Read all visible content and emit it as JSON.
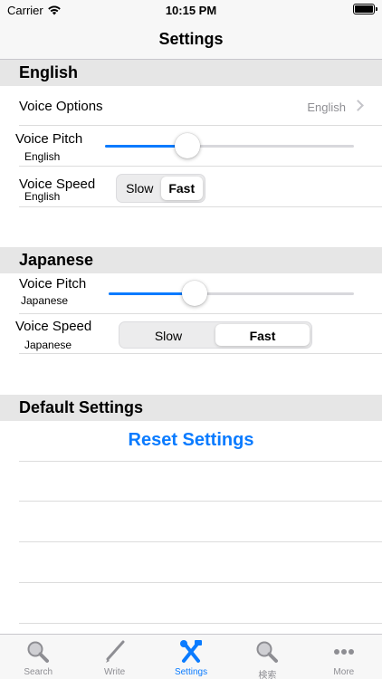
{
  "status": {
    "carrier": "Carrier",
    "time": "10:15 PM"
  },
  "nav": {
    "title": "Settings"
  },
  "sections": {
    "english": {
      "header": "English",
      "voice_options": {
        "label": "Voice Options",
        "value": "English"
      },
      "voice_pitch": {
        "label": "Voice Pitch",
        "sub": "English",
        "value": 0.33
      },
      "voice_speed": {
        "label": "Voice Speed",
        "sub": "English",
        "options": [
          "Slow",
          "Fast"
        ],
        "selected": "Fast"
      }
    },
    "japanese": {
      "header": "Japanese",
      "voice_pitch": {
        "label": "Voice Pitch",
        "sub": "Japanese",
        "value": 0.35
      },
      "voice_speed": {
        "label": "Voice Speed",
        "sub": "Japanese",
        "options": [
          "Slow",
          "Fast"
        ],
        "selected": "Fast"
      }
    },
    "defaults": {
      "header": "Default Settings",
      "reset_label": "Reset Settings"
    }
  },
  "tabbar": {
    "tabs": [
      {
        "label": "Search",
        "icon": "magnifier-icon"
      },
      {
        "label": "Write",
        "icon": "pencil-icon"
      },
      {
        "label": "Settings",
        "icon": "tools-icon",
        "active": true
      },
      {
        "label": "検索",
        "icon": "magnifier-icon"
      },
      {
        "label": "More",
        "icon": "more-dots-icon"
      }
    ]
  },
  "colors": {
    "accent": "#0a7bff",
    "header_bg": "#e6e6e6",
    "inactive_tab": "#8e8e93"
  }
}
